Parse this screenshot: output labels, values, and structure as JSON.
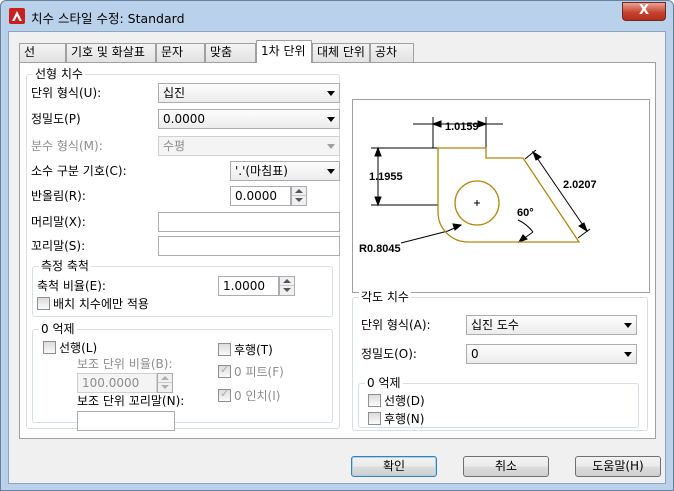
{
  "window": {
    "title": "치수 스타일 수정: Standard",
    "close_label": "X"
  },
  "tabs": [
    {
      "label": "선"
    },
    {
      "label": "기호 및 화살표"
    },
    {
      "label": "문자"
    },
    {
      "label": "맞춤"
    },
    {
      "label": "1차 단위"
    },
    {
      "label": "대체 단위"
    },
    {
      "label": "공차"
    }
  ],
  "active_tab": "1차 단위",
  "linear": {
    "group_title": "선형 치수",
    "unit_format_label": "단위 형식(U):",
    "unit_format_value": "십진",
    "precision_label": "정밀도(P)",
    "precision_value": "0.0000",
    "fraction_format_label": "분수 형식(M):",
    "fraction_format_value": "수평",
    "decimal_sep_label": "소수 구분 기호(C):",
    "decimal_sep_value": "'.'(마침표)",
    "round_off_label": "반올림(R):",
    "round_off_value": "0.0000",
    "prefix_label": "머리말(X):",
    "prefix_value": "",
    "suffix_label": "꼬리말(S):",
    "suffix_value": ""
  },
  "measurement_scale": {
    "group_title": "측정 축척",
    "scale_factor_label": "축척 비율(E):",
    "scale_factor_value": "1.0000",
    "layout_only_label": "배치 치수에만 적용"
  },
  "zero_suppression": {
    "group_title": "0 억제",
    "leading_label": "선행(L)",
    "trailing_label": "후행(T)",
    "sub_factor_label": "보조 단위 비율(B):",
    "sub_factor_value": "100.0000",
    "sub_suffix_label": "보조 단위 꼬리말(N):",
    "sub_suffix_value": "",
    "feet_label": "0 피트(F)",
    "inch_label": "0 인치(I)"
  },
  "preview": {
    "dim_top": "1.0159",
    "dim_left": "1.1955",
    "dim_diag": "2.0207",
    "dim_angle": "60°",
    "dim_radius": "R0.8045"
  },
  "angular": {
    "group_title": "각도 치수",
    "unit_format_label": "단위 형식(A):",
    "unit_format_value": "십진 도수",
    "precision_label": "정밀도(O):",
    "precision_value": "0",
    "zero_group_title": "0 억제",
    "leading_label": "선행(D)",
    "trailing_label": "후행(N)"
  },
  "buttons": {
    "ok": "확인",
    "cancel": "취소",
    "help": "도움말(H)"
  },
  "colors": {
    "title_bg": "#b9d1ea",
    "preview_line": "#b8860b",
    "close_red": "#c7432f"
  }
}
